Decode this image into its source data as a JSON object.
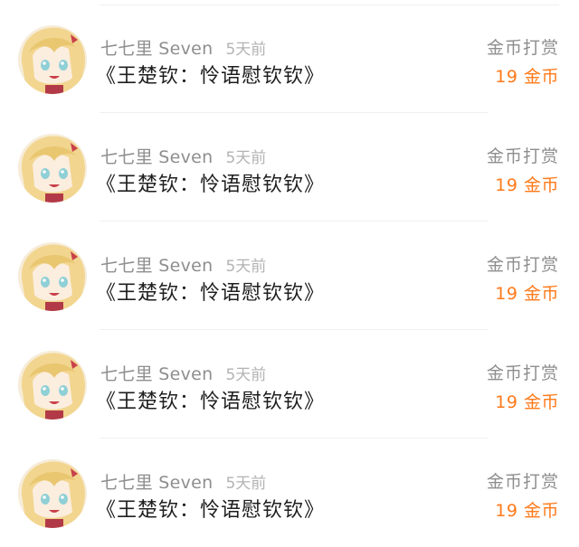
{
  "records": [
    {
      "username": "七七里 Seven",
      "time": "5天前",
      "title": "《王楚钦：怜语慰钦钦》",
      "type": "金币打赏",
      "amount": "19 金币",
      "avatar_icon": "anime-girl-avatar"
    },
    {
      "username": "七七里 Seven",
      "time": "5天前",
      "title": "《王楚钦：怜语慰钦钦》",
      "type": "金币打赏",
      "amount": "19 金币",
      "avatar_icon": "anime-girl-avatar"
    },
    {
      "username": "七七里 Seven",
      "time": "5天前",
      "title": "《王楚钦：怜语慰钦钦》",
      "type": "金币打赏",
      "amount": "19 金币",
      "avatar_icon": "anime-girl-avatar"
    },
    {
      "username": "七七里 Seven",
      "time": "5天前",
      "title": "《王楚钦：怜语慰钦钦》",
      "type": "金币打赏",
      "amount": "19 金币",
      "avatar_icon": "anime-girl-avatar"
    },
    {
      "username": "七七里 Seven",
      "time": "5天前",
      "title": "《王楚钦：怜语慰钦钦》",
      "type": "金币打赏",
      "amount": "19 金币",
      "avatar_icon": "anime-girl-avatar"
    }
  ],
  "colors": {
    "accent": "#ff7a1a",
    "muted_text": "#8e8e8e",
    "primary_text": "#1e1e1e"
  }
}
